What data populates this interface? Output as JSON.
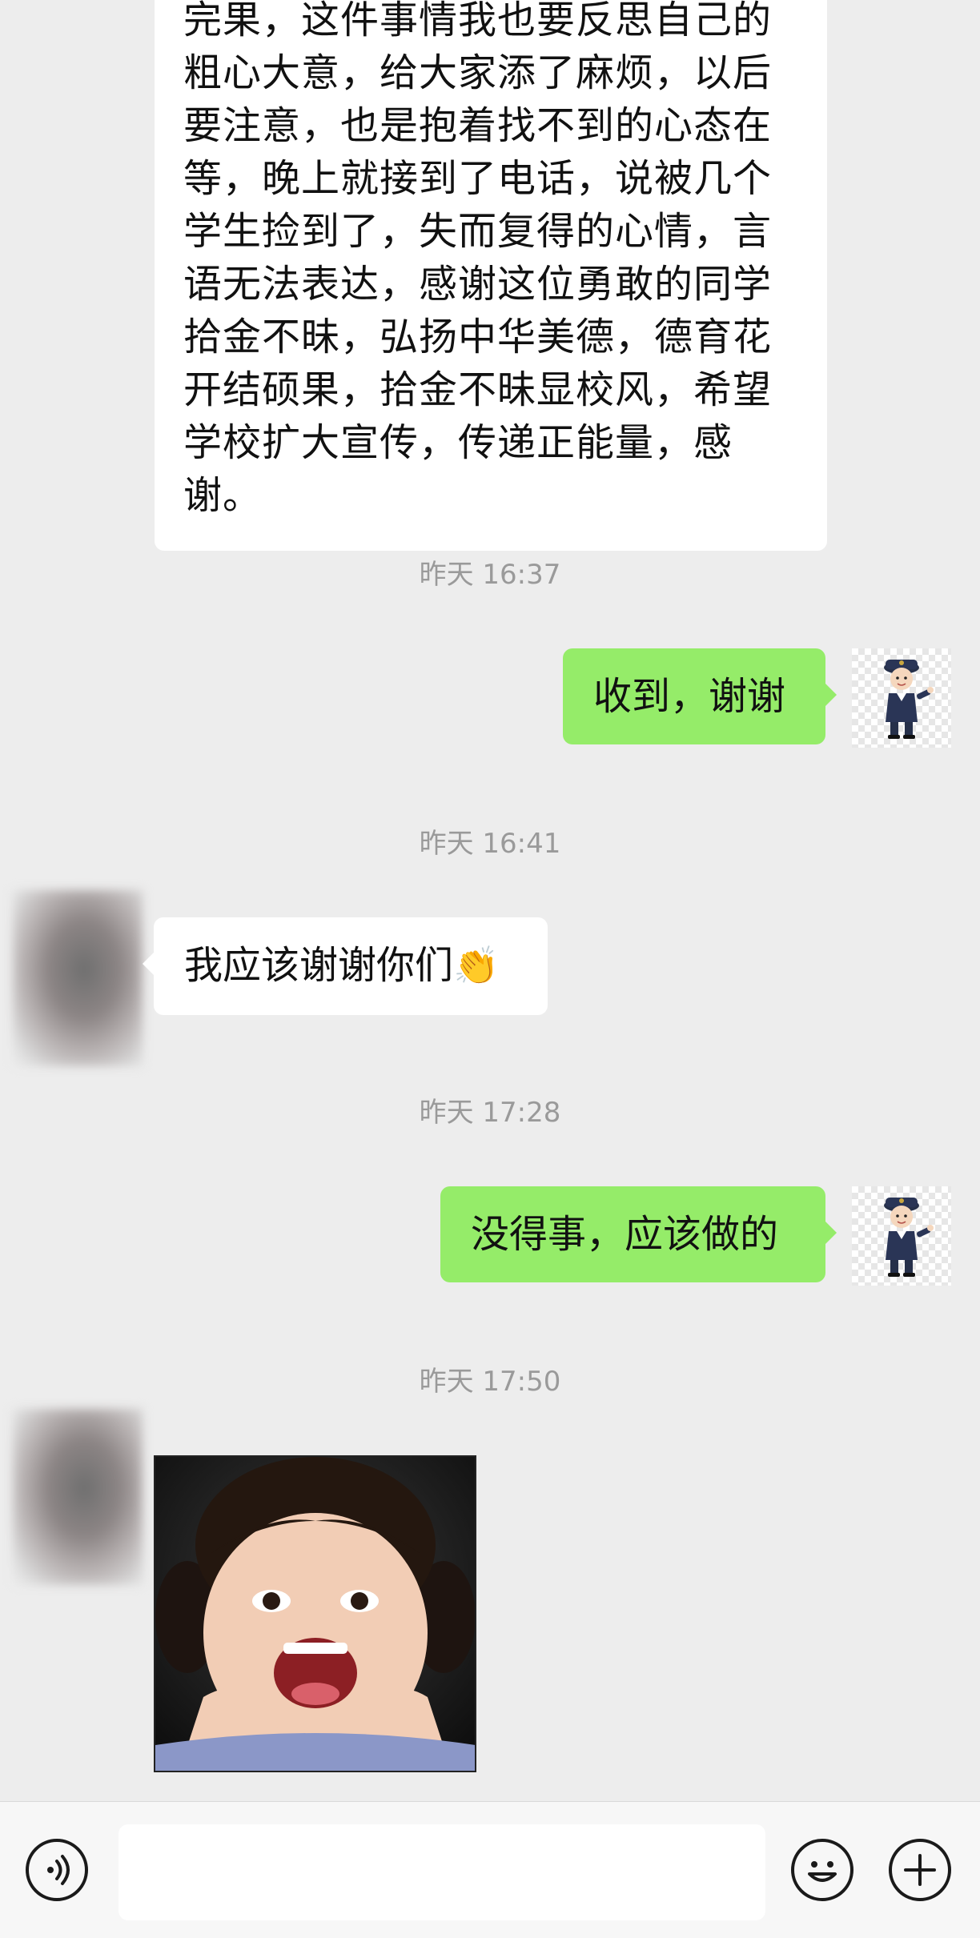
{
  "messages": {
    "long_text": "完果，这件事情我也要反思自己的\n粗心大意，给大家添了麻烦，以后\n要注意，也是抱着找不到的心态在\n等，晚上就接到了电话，说被几个\n学生捡到了，失而复得的心情，言\n语无法表达，感谢这位勇敢的同学\n拾金不昧，弘扬中华美德，德育花\n开结硕果，拾金不昧显校风，希望\n学校扩大宣传，传递正能量，感谢。",
    "ts1": "昨天 16:37",
    "reply1": "收到，谢谢",
    "ts2": "昨天 16:41",
    "incoming2": "我应该谢谢你们",
    "ts3": "昨天 17:28",
    "reply2": "没得事，应该做的",
    "ts4": "昨天 17:50"
  },
  "icons": {
    "voice": "voice-icon",
    "emoji": "emoji-icon",
    "plus": "plus-icon",
    "clap": "👏"
  },
  "colors": {
    "background": "#ededed",
    "sent_bubble": "#95ec69",
    "received_bubble": "#ffffff",
    "timestamp": "#9a9a9a"
  }
}
